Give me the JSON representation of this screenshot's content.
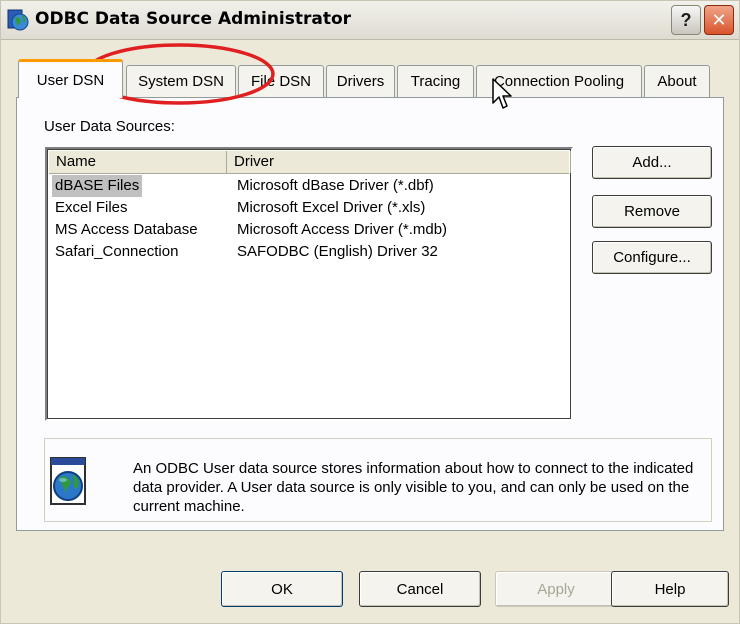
{
  "window": {
    "title": "ODBC Data Source Administrator",
    "help_label": "?",
    "close_label": "✕"
  },
  "tabs": [
    {
      "label": "User DSN",
      "active": true
    },
    {
      "label": "System DSN",
      "active": false
    },
    {
      "label": "File DSN",
      "active": false
    },
    {
      "label": "Drivers",
      "active": false
    },
    {
      "label": "Tracing",
      "active": false
    },
    {
      "label": "Connection Pooling",
      "active": false
    },
    {
      "label": "About",
      "active": false
    }
  ],
  "section_label": "User Data Sources:",
  "list": {
    "columns": [
      "Name",
      "Driver"
    ],
    "rows": [
      {
        "name": "dBASE Files",
        "driver": "Microsoft dBase Driver (*.dbf)",
        "selected": true
      },
      {
        "name": "Excel Files",
        "driver": "Microsoft Excel Driver (*.xls)",
        "selected": false
      },
      {
        "name": "MS Access Database",
        "driver": "Microsoft Access Driver (*.mdb)",
        "selected": false
      },
      {
        "name": "Safari_Connection",
        "driver": "SAFODBC (English) Driver 32",
        "selected": false
      }
    ]
  },
  "side_buttons": {
    "add": "Add...",
    "remove": "Remove",
    "configure": "Configure..."
  },
  "info_text": "An ODBC User data source stores information about how to connect to the indicated data provider.   A User data source is only visible to you, and can only be used on the current machine.",
  "footer_buttons": {
    "ok": "OK",
    "cancel": "Cancel",
    "apply": "Apply",
    "help": "Help"
  },
  "colors": {
    "annotation": "#e02020",
    "active_tab_highlight": "#ff9900",
    "dialog_bg": "#ece9d8"
  },
  "icons": {
    "app": "odbc-globe-icon",
    "info": "database-globe-icon",
    "cursor": "mouse-pointer-icon"
  }
}
